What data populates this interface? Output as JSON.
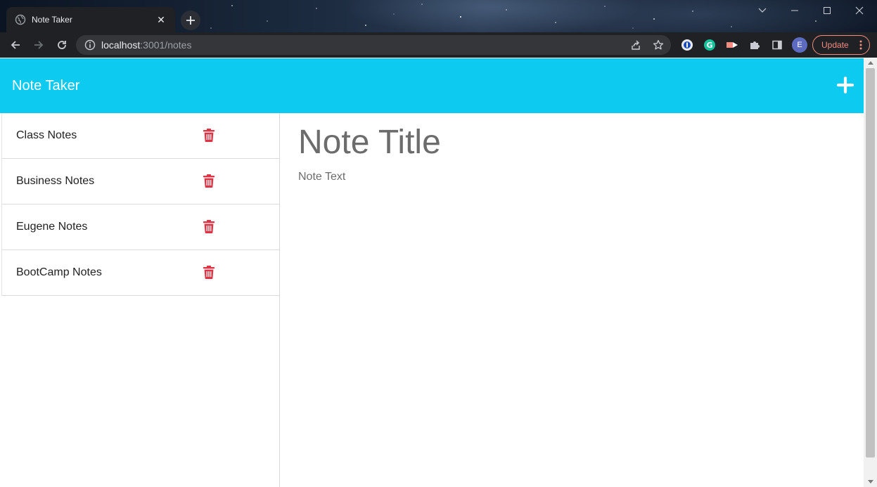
{
  "browser": {
    "tab_title": "Note Taker",
    "url_host": "localhost",
    "url_rest": ":3001/notes",
    "profile_initial": "E",
    "update_label": "Update",
    "extensions": [
      "onepassword-icon",
      "grammarly-icon",
      "video-extension-icon",
      "puzzle-icon"
    ]
  },
  "app": {
    "brand": "Note Taker",
    "accent_color": "#0dcaf0",
    "delete_color": "#dc3545"
  },
  "notes": [
    {
      "title": "Class Notes"
    },
    {
      "title": "Business Notes"
    },
    {
      "title": "Eugene Notes"
    },
    {
      "title": "BootCamp Notes"
    }
  ],
  "editor": {
    "title_placeholder": "Note Title",
    "text_placeholder": "Note Text"
  }
}
